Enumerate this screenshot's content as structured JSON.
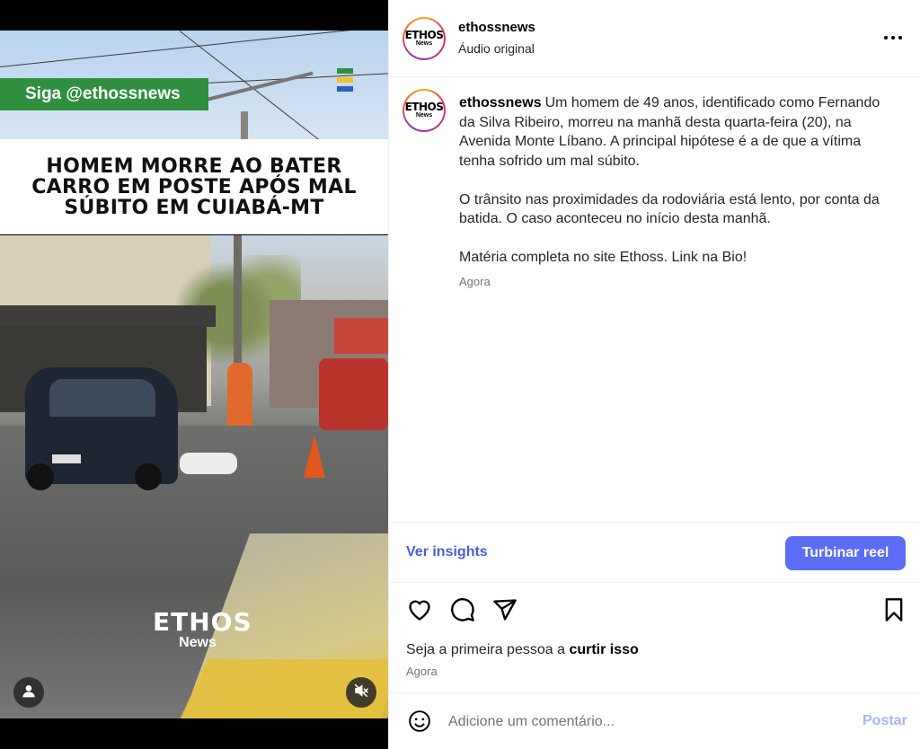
{
  "media": {
    "follow_banner": "Siga @ethossnews",
    "headline": "HOMEM MORRE AO BATER\nCARRO EM POSTE APÓS MAL\nSÚBITO EM CUIABÁ-MT",
    "watermark_top": "ETHOS",
    "watermark_bottom": "News",
    "user_button_icon": "user-icon",
    "mute_button_icon": "speaker-muted-icon"
  },
  "header": {
    "username": "ethossnews",
    "audio": "Áudio original",
    "avatar_text_top": "ETHOS",
    "avatar_text_bottom": "News",
    "more_icon": "more-options-icon"
  },
  "caption": {
    "username": "ethossnews",
    "paragraphs": [
      "Um homem de 49 anos, identificado como Fernando da Silva Ribeiro, morreu na manhã desta quarta-feira (20), na Avenida Monte Líbano. A principal hipótese é a de que a vítima tenha sofrido um mal súbito.",
      "O trânsito nas proximidades da rodoviária está lento, por conta da batida. O caso aconteceu no início desta manhã.",
      "Matéria completa no site Ethoss. Link na Bio!"
    ],
    "time": "Agora"
  },
  "toolbar": {
    "insights_label": "Ver insights",
    "boost_label": "Turbinar reel"
  },
  "actions": {
    "like_icon": "heart-icon",
    "comment_icon": "comment-icon",
    "share_icon": "send-icon",
    "save_icon": "bookmark-icon"
  },
  "likes": {
    "prefix": "Seja a primeira pessoa a ",
    "emphasis": "curtir isso"
  },
  "post_time": "Agora",
  "composer": {
    "emoji_icon": "emoji-icon",
    "placeholder": "Adicione um comentário...",
    "post_label": "Postar"
  },
  "colors": {
    "accent": "#5b6cf5",
    "link": "#4a5dd9",
    "banner_green": "#2f8f3f",
    "post_disabled": "#a5b7f0"
  }
}
